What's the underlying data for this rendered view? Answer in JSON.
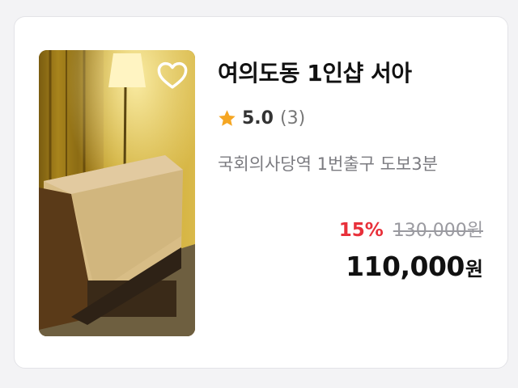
{
  "product": {
    "title": "여의도동 1인샵 서아",
    "rating": "5.0",
    "review_count": "(3)",
    "location": "국회의사당역 1번출구 도보3분",
    "discount": "15%",
    "original_price": "130,000원",
    "final_price": "110,000",
    "currency": "원"
  },
  "icons": {
    "favorite": "heart-outline-icon",
    "rating": "star-icon"
  },
  "colors": {
    "discount": "#e8303a",
    "star": "#f5a623",
    "title": "#111111"
  }
}
